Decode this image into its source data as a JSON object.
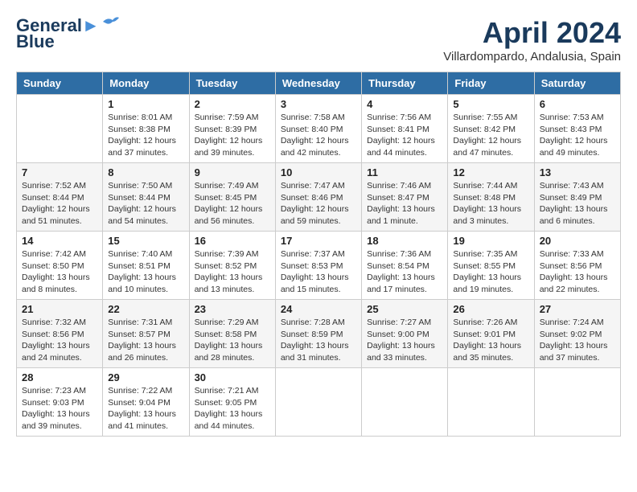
{
  "header": {
    "logo_line1": "General",
    "logo_line2": "Blue",
    "month_title": "April 2024",
    "location": "Villardompardo, Andalusia, Spain"
  },
  "weekdays": [
    "Sunday",
    "Monday",
    "Tuesday",
    "Wednesday",
    "Thursday",
    "Friday",
    "Saturday"
  ],
  "weeks": [
    [
      {
        "day": "",
        "sunrise": "",
        "sunset": "",
        "daylight": ""
      },
      {
        "day": "1",
        "sunrise": "Sunrise: 8:01 AM",
        "sunset": "Sunset: 8:38 PM",
        "daylight": "Daylight: 12 hours and 37 minutes."
      },
      {
        "day": "2",
        "sunrise": "Sunrise: 7:59 AM",
        "sunset": "Sunset: 8:39 PM",
        "daylight": "Daylight: 12 hours and 39 minutes."
      },
      {
        "day": "3",
        "sunrise": "Sunrise: 7:58 AM",
        "sunset": "Sunset: 8:40 PM",
        "daylight": "Daylight: 12 hours and 42 minutes."
      },
      {
        "day": "4",
        "sunrise": "Sunrise: 7:56 AM",
        "sunset": "Sunset: 8:41 PM",
        "daylight": "Daylight: 12 hours and 44 minutes."
      },
      {
        "day": "5",
        "sunrise": "Sunrise: 7:55 AM",
        "sunset": "Sunset: 8:42 PM",
        "daylight": "Daylight: 12 hours and 47 minutes."
      },
      {
        "day": "6",
        "sunrise": "Sunrise: 7:53 AM",
        "sunset": "Sunset: 8:43 PM",
        "daylight": "Daylight: 12 hours and 49 minutes."
      }
    ],
    [
      {
        "day": "7",
        "sunrise": "Sunrise: 7:52 AM",
        "sunset": "Sunset: 8:44 PM",
        "daylight": "Daylight: 12 hours and 51 minutes."
      },
      {
        "day": "8",
        "sunrise": "Sunrise: 7:50 AM",
        "sunset": "Sunset: 8:44 PM",
        "daylight": "Daylight: 12 hours and 54 minutes."
      },
      {
        "day": "9",
        "sunrise": "Sunrise: 7:49 AM",
        "sunset": "Sunset: 8:45 PM",
        "daylight": "Daylight: 12 hours and 56 minutes."
      },
      {
        "day": "10",
        "sunrise": "Sunrise: 7:47 AM",
        "sunset": "Sunset: 8:46 PM",
        "daylight": "Daylight: 12 hours and 59 minutes."
      },
      {
        "day": "11",
        "sunrise": "Sunrise: 7:46 AM",
        "sunset": "Sunset: 8:47 PM",
        "daylight": "Daylight: 13 hours and 1 minute."
      },
      {
        "day": "12",
        "sunrise": "Sunrise: 7:44 AM",
        "sunset": "Sunset: 8:48 PM",
        "daylight": "Daylight: 13 hours and 3 minutes."
      },
      {
        "day": "13",
        "sunrise": "Sunrise: 7:43 AM",
        "sunset": "Sunset: 8:49 PM",
        "daylight": "Daylight: 13 hours and 6 minutes."
      }
    ],
    [
      {
        "day": "14",
        "sunrise": "Sunrise: 7:42 AM",
        "sunset": "Sunset: 8:50 PM",
        "daylight": "Daylight: 13 hours and 8 minutes."
      },
      {
        "day": "15",
        "sunrise": "Sunrise: 7:40 AM",
        "sunset": "Sunset: 8:51 PM",
        "daylight": "Daylight: 13 hours and 10 minutes."
      },
      {
        "day": "16",
        "sunrise": "Sunrise: 7:39 AM",
        "sunset": "Sunset: 8:52 PM",
        "daylight": "Daylight: 13 hours and 13 minutes."
      },
      {
        "day": "17",
        "sunrise": "Sunrise: 7:37 AM",
        "sunset": "Sunset: 8:53 PM",
        "daylight": "Daylight: 13 hours and 15 minutes."
      },
      {
        "day": "18",
        "sunrise": "Sunrise: 7:36 AM",
        "sunset": "Sunset: 8:54 PM",
        "daylight": "Daylight: 13 hours and 17 minutes."
      },
      {
        "day": "19",
        "sunrise": "Sunrise: 7:35 AM",
        "sunset": "Sunset: 8:55 PM",
        "daylight": "Daylight: 13 hours and 19 minutes."
      },
      {
        "day": "20",
        "sunrise": "Sunrise: 7:33 AM",
        "sunset": "Sunset: 8:56 PM",
        "daylight": "Daylight: 13 hours and 22 minutes."
      }
    ],
    [
      {
        "day": "21",
        "sunrise": "Sunrise: 7:32 AM",
        "sunset": "Sunset: 8:56 PM",
        "daylight": "Daylight: 13 hours and 24 minutes."
      },
      {
        "day": "22",
        "sunrise": "Sunrise: 7:31 AM",
        "sunset": "Sunset: 8:57 PM",
        "daylight": "Daylight: 13 hours and 26 minutes."
      },
      {
        "day": "23",
        "sunrise": "Sunrise: 7:29 AM",
        "sunset": "Sunset: 8:58 PM",
        "daylight": "Daylight: 13 hours and 28 minutes."
      },
      {
        "day": "24",
        "sunrise": "Sunrise: 7:28 AM",
        "sunset": "Sunset: 8:59 PM",
        "daylight": "Daylight: 13 hours and 31 minutes."
      },
      {
        "day": "25",
        "sunrise": "Sunrise: 7:27 AM",
        "sunset": "Sunset: 9:00 PM",
        "daylight": "Daylight: 13 hours and 33 minutes."
      },
      {
        "day": "26",
        "sunrise": "Sunrise: 7:26 AM",
        "sunset": "Sunset: 9:01 PM",
        "daylight": "Daylight: 13 hours and 35 minutes."
      },
      {
        "day": "27",
        "sunrise": "Sunrise: 7:24 AM",
        "sunset": "Sunset: 9:02 PM",
        "daylight": "Daylight: 13 hours and 37 minutes."
      }
    ],
    [
      {
        "day": "28",
        "sunrise": "Sunrise: 7:23 AM",
        "sunset": "Sunset: 9:03 PM",
        "daylight": "Daylight: 13 hours and 39 minutes."
      },
      {
        "day": "29",
        "sunrise": "Sunrise: 7:22 AM",
        "sunset": "Sunset: 9:04 PM",
        "daylight": "Daylight: 13 hours and 41 minutes."
      },
      {
        "day": "30",
        "sunrise": "Sunrise: 7:21 AM",
        "sunset": "Sunset: 9:05 PM",
        "daylight": "Daylight: 13 hours and 44 minutes."
      },
      {
        "day": "",
        "sunrise": "",
        "sunset": "",
        "daylight": ""
      },
      {
        "day": "",
        "sunrise": "",
        "sunset": "",
        "daylight": ""
      },
      {
        "day": "",
        "sunrise": "",
        "sunset": "",
        "daylight": ""
      },
      {
        "day": "",
        "sunrise": "",
        "sunset": "",
        "daylight": ""
      }
    ]
  ]
}
